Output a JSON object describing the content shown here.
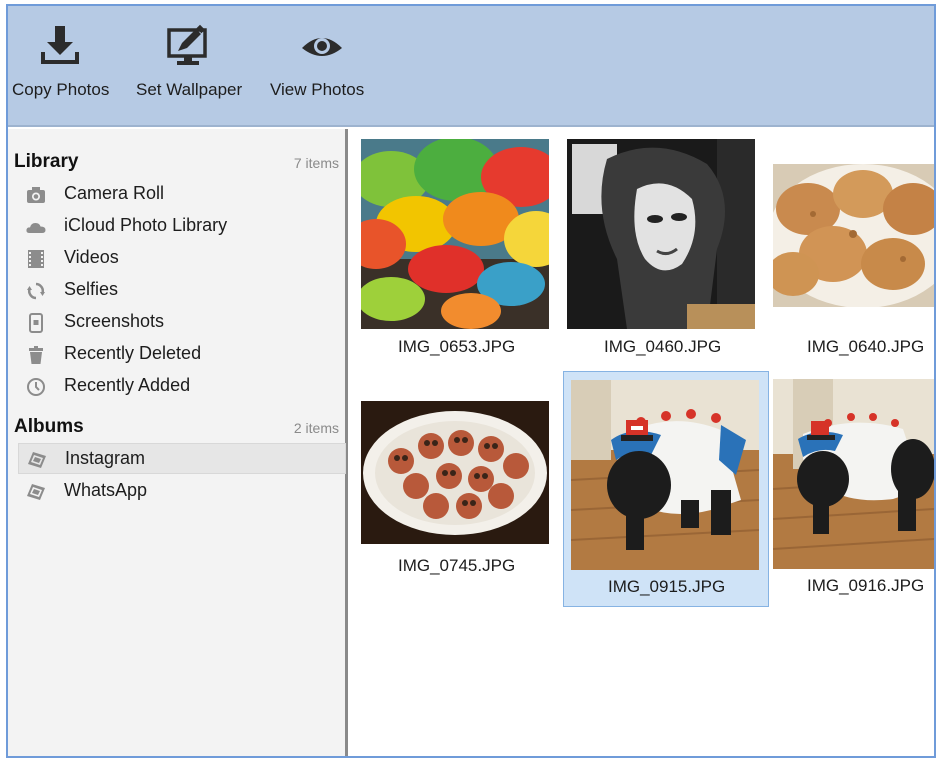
{
  "toolbar": {
    "copy_label": "Copy Photos",
    "wallpaper_label": "Set Wallpaper",
    "view_label": "View Photos"
  },
  "sidebar": {
    "library": {
      "title": "Library",
      "count": "7 items",
      "items": [
        {
          "label": "Camera Roll",
          "icon": "camera-icon"
        },
        {
          "label": "iCloud Photo Library",
          "icon": "cloud-icon"
        },
        {
          "label": "Videos",
          "icon": "film-icon"
        },
        {
          "label": "Selfies",
          "icon": "rotate-icon"
        },
        {
          "label": "Screenshots",
          "icon": "phone-icon"
        },
        {
          "label": "Recently Deleted",
          "icon": "trash-icon"
        },
        {
          "label": "Recently Added",
          "icon": "clock-icon"
        }
      ]
    },
    "albums": {
      "title": "Albums",
      "count": "2 items",
      "items": [
        {
          "label": "Instagram",
          "icon": "album-icon",
          "selected": true
        },
        {
          "label": "WhatsApp",
          "icon": "album-icon",
          "selected": false
        }
      ]
    }
  },
  "photos": [
    {
      "name": "IMG_0653.JPG",
      "subject": "colorful umbrellas"
    },
    {
      "name": "IMG_0460.JPG",
      "subject": "black and white portrait poster"
    },
    {
      "name": "IMG_0640.JPG",
      "subject": "cookies on a plate"
    },
    {
      "name": "IMG_0745.JPG",
      "subject": "owl cupcakes on a plate"
    },
    {
      "name": "IMG_0915.JPG",
      "subject": "dog in a sweater",
      "selected": true
    },
    {
      "name": "IMG_0916.JPG",
      "subject": "dog in a sweater"
    }
  ],
  "colors": {
    "toolbar_bg": "#b6cae4",
    "window_border": "#6f9bd9",
    "selection": "#cfe3f7"
  }
}
